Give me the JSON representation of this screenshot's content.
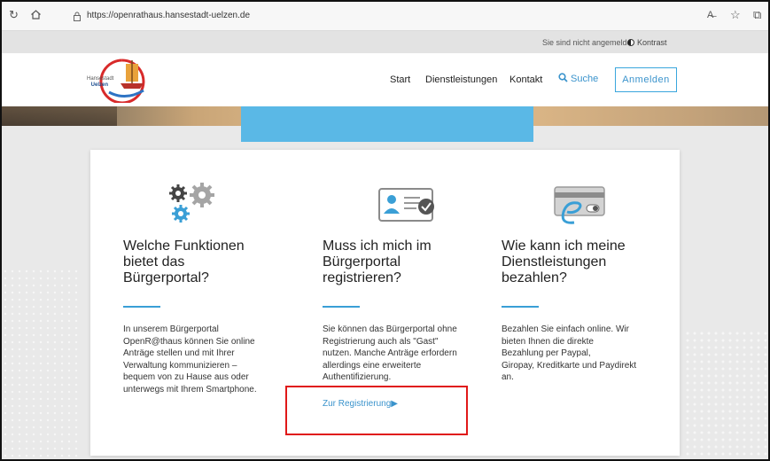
{
  "browser": {
    "url": "https://openrathaus.hansestadt-uelzen.de",
    "icons": [
      "reload-icon",
      "home-icon",
      "lock-icon",
      "read-aloud-icon",
      "favorites-icon",
      "collections-icon"
    ]
  },
  "topbar": {
    "login_status": "Sie sind nicht angemeldet",
    "contrast_label": "Kontrast"
  },
  "header": {
    "logo_line1": "Hansestadt",
    "logo_line2": "Uelzen",
    "nav": [
      {
        "label": "Start"
      },
      {
        "label": "Dienstleistungen"
      },
      {
        "label": "Kontakt"
      }
    ],
    "search_label": "Suche",
    "login_button": "Anmelden"
  },
  "columns": [
    {
      "icon": "gears-icon",
      "title_lines": [
        "Welche Funktionen",
        "bietet das",
        "Bürgerportal?"
      ],
      "text_lines": [
        "In unserem Bürgerportal",
        "OpenR@thaus können Sie online",
        "Anträge stellen und mit Ihrer",
        "Verwaltung kommunizieren –",
        "bequem von zu Hause aus oder",
        "unterwegs mit Ihrem Smartphone."
      ]
    },
    {
      "icon": "id-card-check-icon",
      "title_lines": [
        "Muss ich mich im",
        "Bürgerportal",
        "registrieren?"
      ],
      "text_lines": [
        "Sie können das Bürgerportal ohne",
        "Registrierung auch als \"Gast\"",
        "nutzen. Manche Anträge erfordern",
        "allerdings eine erweiterte",
        "Authentifizierung."
      ],
      "link": "Zur Registrierung"
    },
    {
      "icon": "payment-card-icon",
      "title_lines": [
        "Wie kann ich meine",
        "Dienstleistungen",
        "bezahlen?"
      ],
      "text_lines": [
        "Bezahlen Sie einfach online. Wir",
        "bieten Ihnen die direkte",
        "Bezahlung per Paypal,",
        "Giropay, Kreditkarte und Paydirekt",
        "an."
      ]
    }
  ],
  "colors": {
    "accent": "#3a93cc",
    "hero_blue": "#5ab8e6",
    "highlight_red": "#e01818"
  }
}
